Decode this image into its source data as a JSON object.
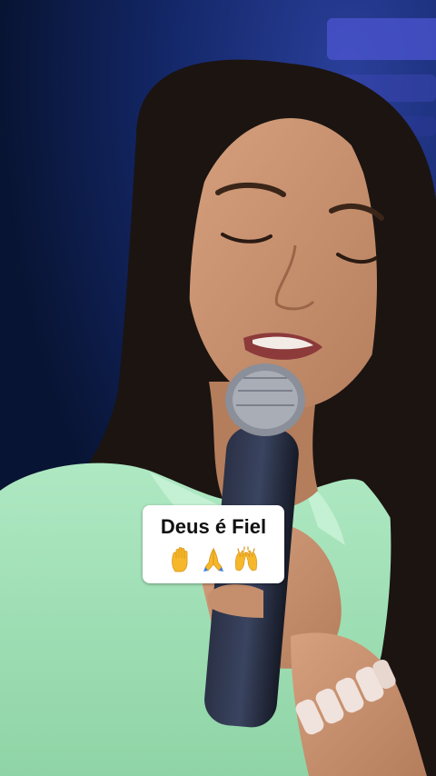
{
  "caption": {
    "title": "Deus é Fiel",
    "emojis": [
      "raised-hand-icon",
      "folded-hands-icon",
      "raising-hands-icon"
    ]
  },
  "colors": {
    "background": "#0b1a3c",
    "stage_light": "#3c4ab8",
    "hair": "#1b1411",
    "skin": "#c58f6e",
    "shirt": "#9fe0b5",
    "microphone": "#1f2535",
    "caption_bg": "#ffffff",
    "emoji_yellow": "#f6b72a"
  }
}
